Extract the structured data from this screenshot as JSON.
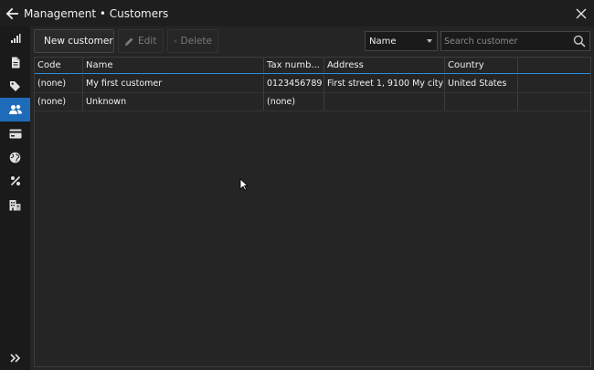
{
  "window": {
    "title": "Management • Customers",
    "back_icon": "arrow-left-icon",
    "close_icon": "close-icon"
  },
  "sidebar": {
    "items": [
      {
        "name": "sidebar-item-dashboard",
        "icon": "bar-chart-icon",
        "active": false
      },
      {
        "name": "sidebar-item-documents",
        "icon": "document-icon",
        "active": false
      },
      {
        "name": "sidebar-item-products",
        "icon": "tag-icon",
        "active": false
      },
      {
        "name": "sidebar-item-customers",
        "icon": "users-icon",
        "active": true
      },
      {
        "name": "sidebar-item-payment-types",
        "icon": "credit-card-icon",
        "active": false
      },
      {
        "name": "sidebar-item-countries",
        "icon": "globe-icon",
        "active": false
      },
      {
        "name": "sidebar-item-tax-rates",
        "icon": "percent-icon",
        "active": false
      },
      {
        "name": "sidebar-item-company",
        "icon": "building-icon",
        "active": false
      }
    ],
    "expand_icon": "double-chevron-right-icon"
  },
  "toolbar": {
    "new_label": "New customer",
    "edit_label": "Edit",
    "delete_label": "Delete",
    "filter_field": {
      "selected": "Name"
    },
    "search": {
      "placeholder": "Search customer",
      "value": ""
    }
  },
  "grid": {
    "columns": [
      "Code",
      "Name",
      "Tax numb...",
      "Address",
      "Country",
      ""
    ],
    "rows": [
      {
        "code": "(none)",
        "name": "My first customer",
        "tax": "0123456789",
        "address": "First street 1, 9100 My city",
        "country": "United States"
      },
      {
        "code": "(none)",
        "name": "Unknown",
        "tax": "(none)",
        "address": "",
        "country": ""
      }
    ]
  },
  "colors": {
    "accent": "#1e6bb8",
    "header_underline": "#2b8fe0",
    "background": "#252525"
  }
}
